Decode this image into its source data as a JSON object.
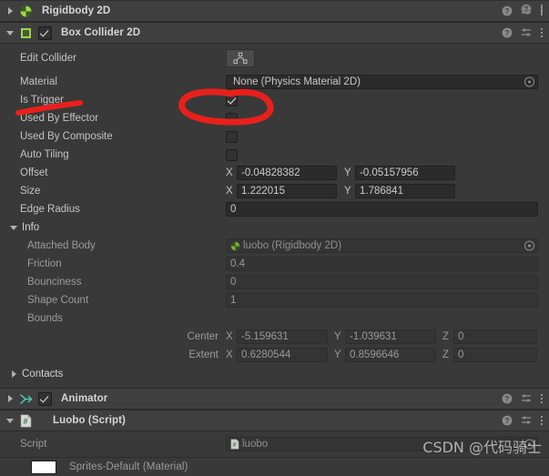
{
  "components": [
    {
      "name": "Rigidbody 2D",
      "icon": "rigidbody2d-icon",
      "expanded": false,
      "has_enable_checkbox": false
    },
    {
      "name": "Box Collider 2D",
      "icon": "boxcollider2d-icon",
      "expanded": true,
      "has_enable_checkbox": true,
      "enabled": true
    },
    {
      "name": "Animator",
      "icon": "animator-icon",
      "expanded": false,
      "has_enable_checkbox": true,
      "enabled": true
    },
    {
      "name": "Luobo (Script)",
      "icon": "cs-script-icon",
      "expanded": true,
      "has_enable_checkbox": false
    }
  ],
  "header_tools": {
    "help": "help-icon",
    "preset": "preset-icon",
    "menu": "kebab-menu-icon"
  },
  "box_collider": {
    "edit_collider": {
      "label": "Edit Collider",
      "button_icon": "edit-collider-icon"
    },
    "material": {
      "label": "Material",
      "value": "None (Physics Material 2D)"
    },
    "is_trigger": {
      "label": "Is Trigger",
      "checked": true
    },
    "used_by_effector": {
      "label": "Used By Effector",
      "checked": false
    },
    "used_by_composite": {
      "label": "Used By Composite",
      "checked": false
    },
    "auto_tiling": {
      "label": "Auto Tiling",
      "checked": false
    },
    "offset": {
      "label": "Offset",
      "x_axis": "X",
      "x": "-0.04828382",
      "y_axis": "Y",
      "y": "-0.05157956"
    },
    "size": {
      "label": "Size",
      "x_axis": "X",
      "x": "1.222015",
      "y_axis": "Y",
      "y": "1.786841"
    },
    "edge_radius": {
      "label": "Edge Radius",
      "value": "0"
    },
    "info": {
      "label": "Info",
      "expanded": true,
      "attached_body": {
        "label": "Attached Body",
        "value": "luobo (Rigidbody 2D)"
      },
      "friction": {
        "label": "Friction",
        "value": "0.4"
      },
      "bounciness": {
        "label": "Bounciness",
        "value": "0"
      },
      "shape_count": {
        "label": "Shape Count",
        "value": "1"
      },
      "bounds": {
        "label": "Bounds",
        "center": {
          "label": "Center",
          "x_axis": "X",
          "x": "-5.159631",
          "y_axis": "Y",
          "y": "-1.039631",
          "z_axis": "Z",
          "z": "0"
        },
        "extent": {
          "label": "Extent",
          "x_axis": "X",
          "x": "0.6280544",
          "y_axis": "Y",
          "y": "0.8596646",
          "z_axis": "Z",
          "z": "0"
        }
      }
    },
    "contacts": {
      "label": "Contacts",
      "expanded": false
    }
  },
  "luobo_script": {
    "script": {
      "label": "Script",
      "value": "luobo"
    }
  },
  "material_section": {
    "title": "Sprites-Default (Material)"
  },
  "watermark": {
    "text": "CSDN @代码骑士"
  },
  "annotation": {
    "color": "#e8201b",
    "shapes": [
      "ellipse-around-is-trigger-checkbox",
      "underline-under-is-trigger-label"
    ]
  }
}
